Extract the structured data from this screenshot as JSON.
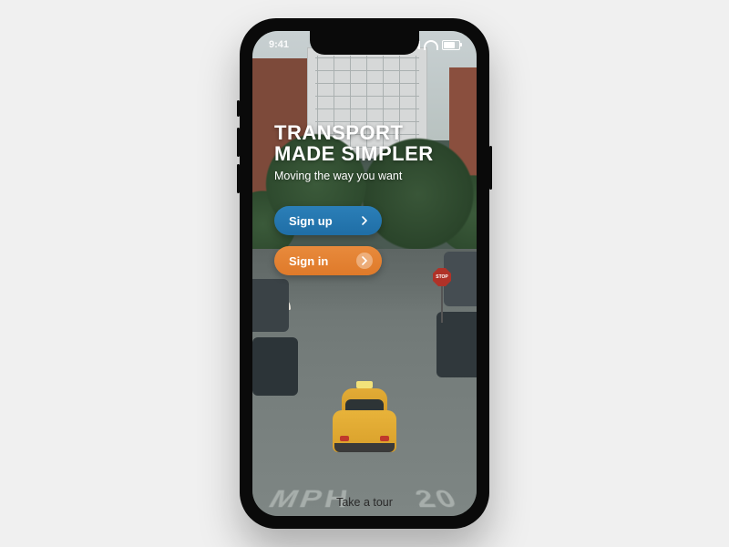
{
  "status": {
    "time": "9:41"
  },
  "hero": {
    "headline": "TRANSPORT\nMADE SIMPLER",
    "tagline": "Moving the way you want"
  },
  "buttons": {
    "signup": "Sign up",
    "signin": "Sign in"
  },
  "footer": {
    "tour": "Take a tour"
  },
  "signs": {
    "stop": "STOP"
  },
  "road": {
    "left": "MPH",
    "right": "20"
  },
  "colors": {
    "primary": "#2b7fb8",
    "secondary": "#e88a3c"
  }
}
